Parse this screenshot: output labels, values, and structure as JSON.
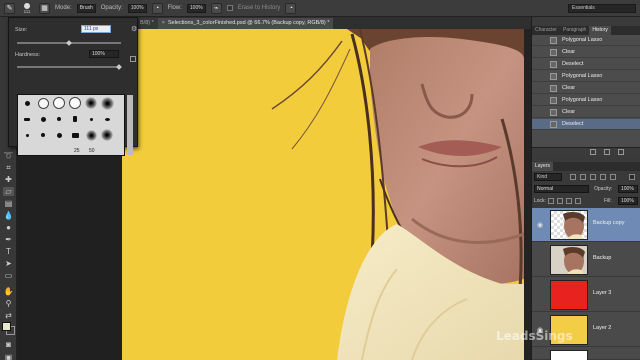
{
  "options_bar": {
    "tool_icon": "brush-icon",
    "brush_size": "111",
    "mode_label": "Mode:",
    "mode_value": "Brush",
    "opacity_label": "Opacity:",
    "opacity_value": "100%",
    "flow_label": "Flow:",
    "flow_value": "100%",
    "erase_history_label": "Erase to History",
    "workspace": "Essentials"
  },
  "brush_picker": {
    "size_label": "Size:",
    "size_value": "111 px",
    "hardness_label": "Hardness:",
    "hardness_value": "100%",
    "preset_labels": [
      "25",
      "50"
    ]
  },
  "document": {
    "prev_tab": "B/8) *",
    "tab_title": "Selections_3_colorFinished.psd @ 66.7% (Backup copy, RGB/8) *",
    "close_symbol": "×"
  },
  "panels": {
    "top_tabs": [
      "Character",
      "Paragraph",
      "History"
    ],
    "history_items": [
      "Polygonal Lasso",
      "Clear",
      "Deselect",
      "Polygonal Lasso",
      "Clear",
      "Polygonal Lasso",
      "Clear",
      "Deselect"
    ],
    "layers_tab": "Layers",
    "filter_kind": "Kind",
    "blend_mode": "Normal",
    "opacity_label": "Opacity:",
    "opacity_value": "100%",
    "lock_label": "Lock:",
    "fill_label": "Fill:",
    "fill_value": "100%",
    "layers": [
      {
        "name": "Backup copy",
        "thumb": "photo",
        "selected": true,
        "visible": true
      },
      {
        "name": "Backup",
        "thumb": "photo",
        "selected": false,
        "visible": false
      },
      {
        "name": "Layer 3",
        "thumb": "#e8231f",
        "selected": false,
        "visible": false
      },
      {
        "name": "Layer 2",
        "thumb": "#f4cd46",
        "selected": false,
        "visible": true
      }
    ]
  },
  "colors": {
    "canvas_bg": "#f2cc3a",
    "selection": "#6e8ab5",
    "foreground": "#eae6cc"
  },
  "watermark": "LeadsSings"
}
